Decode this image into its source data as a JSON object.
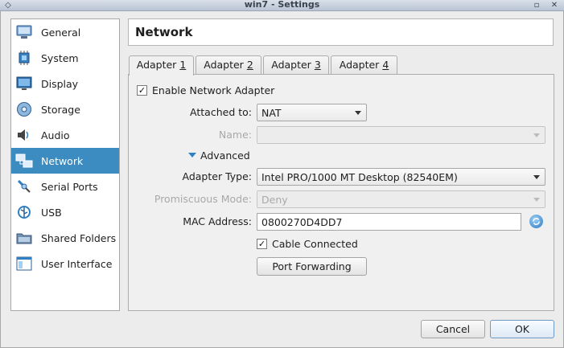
{
  "window": {
    "title": "win7 - Settings"
  },
  "sidebar": {
    "items": [
      {
        "label": "General",
        "icon": "general-icon"
      },
      {
        "label": "System",
        "icon": "system-icon"
      },
      {
        "label": "Display",
        "icon": "display-icon"
      },
      {
        "label": "Storage",
        "icon": "storage-icon"
      },
      {
        "label": "Audio",
        "icon": "audio-icon"
      },
      {
        "label": "Network",
        "icon": "network-icon",
        "selected": true
      },
      {
        "label": "Serial Ports",
        "icon": "serial-ports-icon"
      },
      {
        "label": "USB",
        "icon": "usb-icon"
      },
      {
        "label": "Shared Folders",
        "icon": "shared-folders-icon"
      },
      {
        "label": "User Interface",
        "icon": "user-interface-icon"
      }
    ]
  },
  "page": {
    "title": "Network"
  },
  "tabs": [
    {
      "label": "Adapter ",
      "key": "1",
      "selected": true
    },
    {
      "label": "Adapter ",
      "key": "2"
    },
    {
      "label": "Adapter ",
      "key": "3"
    },
    {
      "label": "Adapter ",
      "key": "4"
    }
  ],
  "adapter": {
    "enable_label": "Enable Network Adapter",
    "enable_checked": true,
    "attached_to_label": "Attached to:",
    "attached_to_value": "NAT",
    "name_label": "Name:",
    "name_value": "",
    "advanced_label": "Advanced",
    "adapter_type_label": "Adapter Type:",
    "adapter_type_value": "Intel PRO/1000 MT Desktop (82540EM)",
    "promiscuous_label": "Promiscuous Mode:",
    "promiscuous_value": "Deny",
    "mac_label": "MAC Address:",
    "mac_value": "0800270D4DD7",
    "cable_label": "Cable Connected",
    "cable_checked": true,
    "port_forwarding_label": "Port Forwarding"
  },
  "buttons": {
    "cancel": "Cancel",
    "ok": "OK"
  },
  "colors": {
    "selection": "#3c8cc2",
    "accent": "#2f7fc1"
  }
}
